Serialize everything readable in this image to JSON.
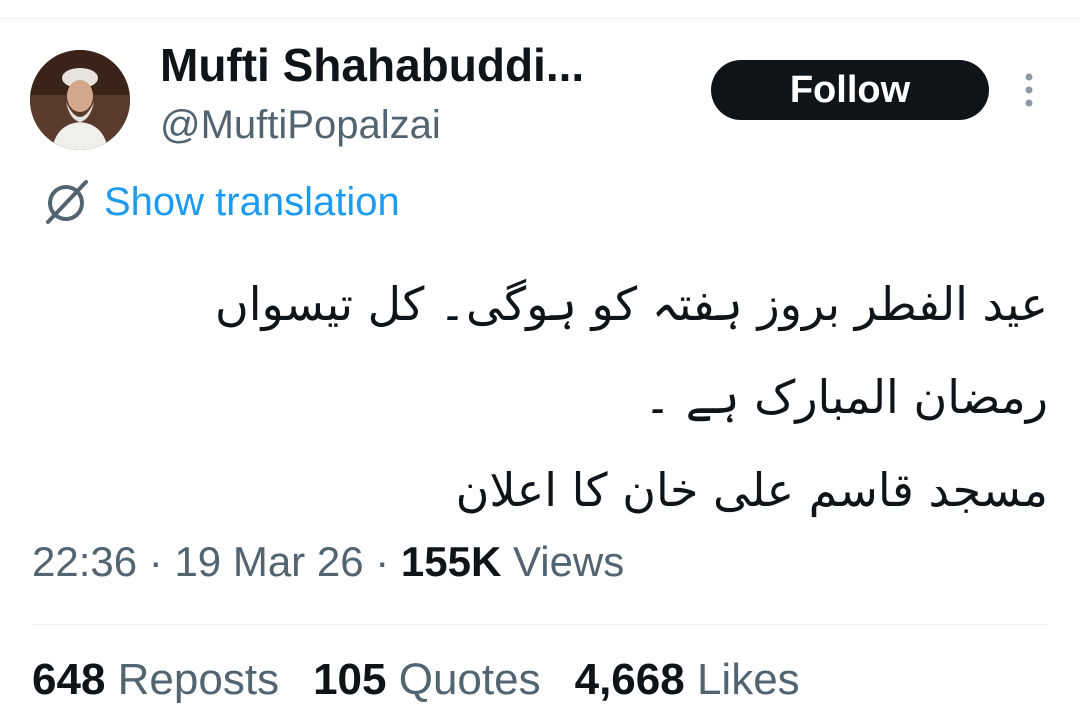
{
  "author": {
    "name": "Mufti Shahabuddi...",
    "handle": "@MuftiPopalzai"
  },
  "follow_label": "Follow",
  "translate_label": "Show translation",
  "tweet_lines": [
    "عید الفطر بروز ہفتہ کو ہوگی۔ کل تیسواں",
    "رمضان المبارک ہے ۔",
    "مسجد قاسم علی خان کا اعلان"
  ],
  "meta": {
    "time": "22:36",
    "date": "19 Mar 26",
    "views_count": "155K",
    "views_label": "Views",
    "separator": "·"
  },
  "stats": {
    "reposts_count": "648",
    "reposts_label": "Reposts",
    "quotes_count": "105",
    "quotes_label": "Quotes",
    "likes_count": "4,668",
    "likes_label": "Likes"
  },
  "colors": {
    "accent": "#1d9bf0",
    "muted": "#536471",
    "text": "#0f1419"
  }
}
